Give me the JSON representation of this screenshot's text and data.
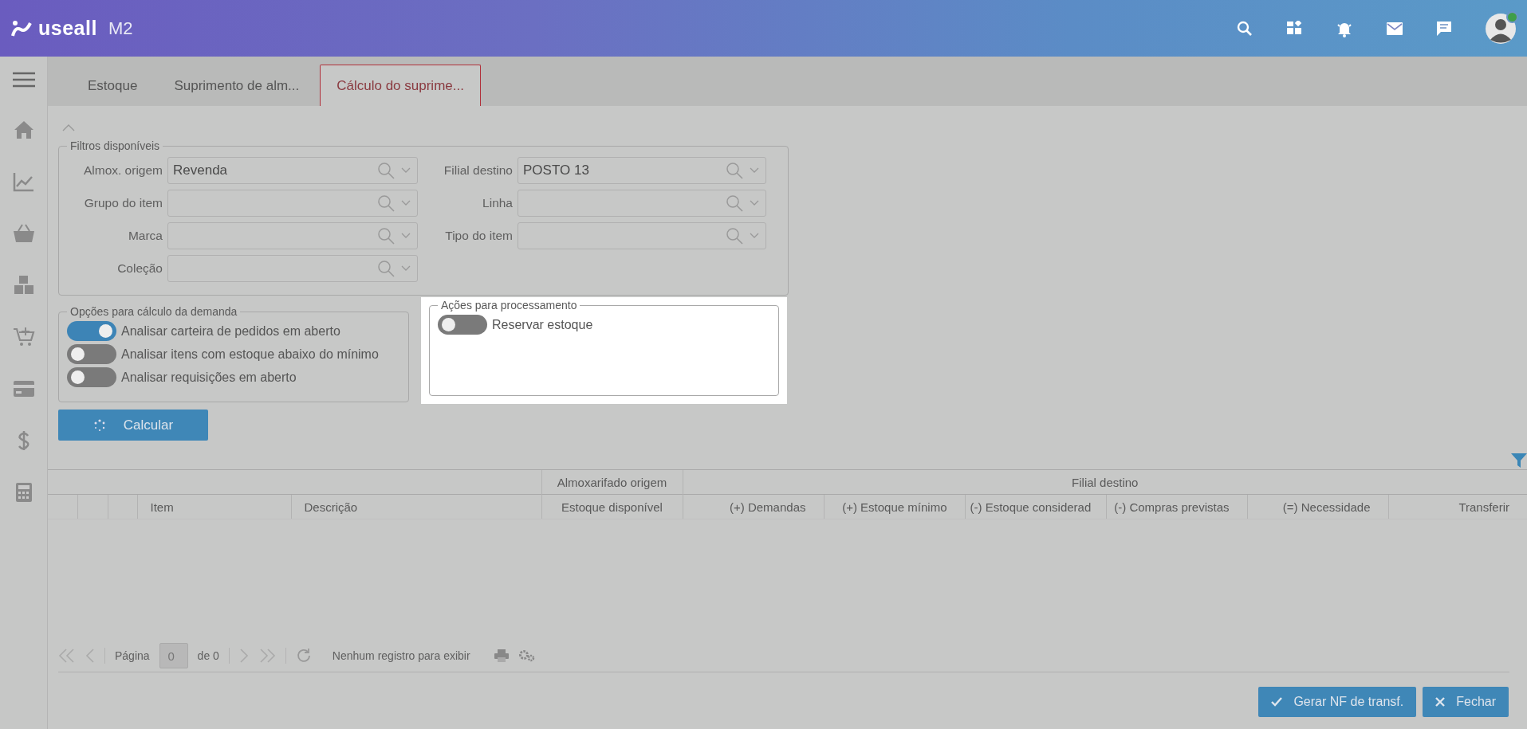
{
  "header": {
    "logo": "useall",
    "logo_suffix": "M2"
  },
  "tabs": [
    {
      "label": "Estoque",
      "selected": false
    },
    {
      "label": "Suprimento de alm...",
      "selected": false
    },
    {
      "label": "Cálculo do suprime...",
      "selected": true
    }
  ],
  "filters": {
    "title": "Filtros disponíveis",
    "fields": [
      {
        "label": "Almox. origem",
        "value": "Revenda"
      },
      {
        "label": "Filial destino",
        "value": "POSTO 13"
      },
      {
        "label": "Grupo do item"
      },
      {
        "label": "Linha"
      },
      {
        "label": "Marca"
      },
      {
        "label": "Tipo do item"
      },
      {
        "label": "Coleção"
      }
    ]
  },
  "demand_options": {
    "title": "Opções para cálculo da demanda",
    "toggles": [
      {
        "label": "Analisar carteira de pedidos em aberto",
        "on": true
      },
      {
        "label": "Analisar itens com estoque abaixo do mínimo",
        "on": false
      },
      {
        "label": "Analisar requisições em aberto",
        "on": false
      }
    ]
  },
  "processing_actions": {
    "title": "Ações para processamento",
    "toggles": [
      {
        "label": "Reservar estoque",
        "on": false
      }
    ]
  },
  "calculate_button": {
    "label": "Calcular"
  },
  "table": {
    "column_groups": [
      "Almoxarifado origem",
      "Filial destino"
    ],
    "columns": [
      "Item",
      "Descrição",
      "Estoque disponível",
      "(+) Demandas",
      "(+) Estoque mínimo",
      "(-) Estoque considerad",
      "(-) Compras previstas",
      "(=) Necessidade",
      "Transferir"
    ]
  },
  "pager": {
    "page_label": "Página",
    "page_value": "0",
    "of_label": "de 0",
    "message": "Nenhum registro para exibir"
  },
  "footer_buttons": [
    {
      "label": "Gerar NF de transf.",
      "kind": "confirm"
    },
    {
      "label": "Fechar",
      "kind": "close"
    }
  ]
}
